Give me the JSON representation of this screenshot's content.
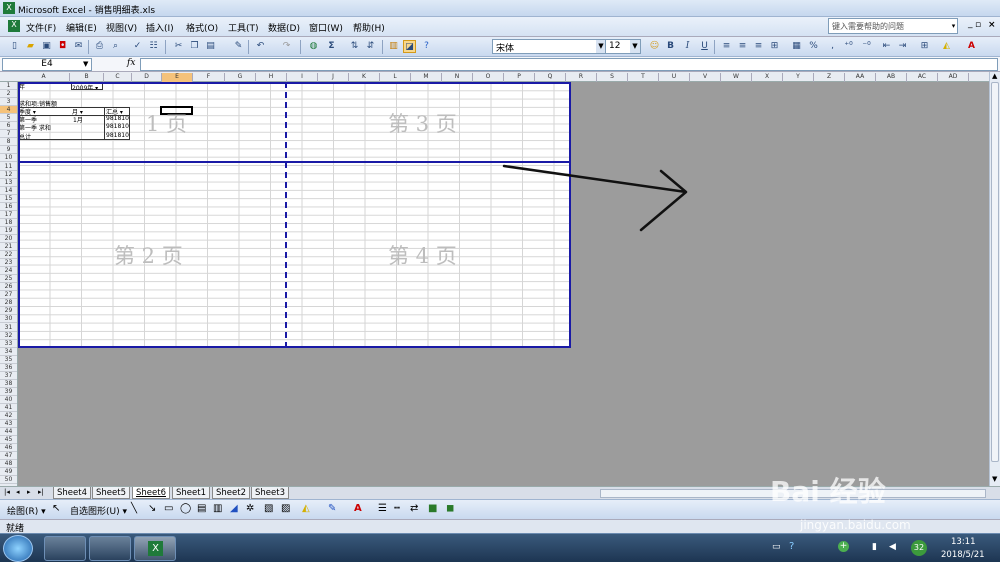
{
  "window": {
    "title": "Microsoft Excel - 销售明细表.xls"
  },
  "menu": [
    "文件(F)",
    "编辑(E)",
    "视图(V)",
    "插入(I)",
    "格式(O)",
    "工具(T)",
    "数据(D)",
    "窗口(W)",
    "帮助(H)"
  ],
  "help_placeholder": "键入需要帮助的问题",
  "toolbar": {
    "font": "宋体",
    "size": "12",
    "bold": "B",
    "italic": "I",
    "underline": "U",
    "percent": "%",
    "comma": ","
  },
  "formula": {
    "cell_ref": "E4",
    "fx": "fx",
    "value": ""
  },
  "columns": [
    "A",
    "B",
    "C",
    "D",
    "E",
    "F",
    "G",
    "H",
    "I",
    "J",
    "K",
    "L",
    "M",
    "N",
    "O",
    "P",
    "Q",
    "R",
    "S",
    "T",
    "U",
    "V",
    "W",
    "X",
    "Y",
    "Z",
    "AA",
    "AB",
    "AC",
    "AD"
  ],
  "rows": [
    "1",
    "2",
    "3",
    "4",
    "5",
    "6",
    "7",
    "8",
    "9",
    "10",
    "11",
    "12",
    "13",
    "14",
    "15",
    "16",
    "17",
    "18",
    "19",
    "20",
    "21",
    "22",
    "23",
    "24",
    "25",
    "26",
    "27",
    "28",
    "29",
    "30",
    "31",
    "32",
    "33",
    "34",
    "35",
    "36",
    "37",
    "38",
    "39",
    "40",
    "41",
    "42",
    "43",
    "44",
    "45",
    "46",
    "47",
    "48",
    "49",
    "50"
  ],
  "pivot": {
    "r1a": "年",
    "r1b": "2009年 ▾",
    "r3a": "求和项:销售额",
    "r4a": "季度 ▾",
    "r4b": "月 ▾",
    "r4c": "汇总 ▾",
    "r5a": "第一季",
    "r5b": "1月",
    "r5c": "981810",
    "r6a": "第一季 求和",
    "r6c": "981810",
    "r7a": "总计",
    "r7c": "981810"
  },
  "pages": {
    "p1": "1 页",
    "p2": "第 2 页",
    "p3": "第 3 页",
    "p4": "第 4 页"
  },
  "tabs": [
    "Sheet4",
    "Sheet5",
    "Sheet6",
    "Sheet1",
    "Sheet2",
    "Sheet3"
  ],
  "active_tab": "Sheet6",
  "drawbar": {
    "draw": "绘图(R) ▾",
    "autoshape": "自选图形(U) ▾"
  },
  "status": "就绪",
  "watermark": {
    "brand": "Bai 经验",
    "url": "jingyan.baidu.com"
  },
  "taskbar": {
    "time": "13:11",
    "date": "2018/5/21",
    "badge": "32"
  }
}
